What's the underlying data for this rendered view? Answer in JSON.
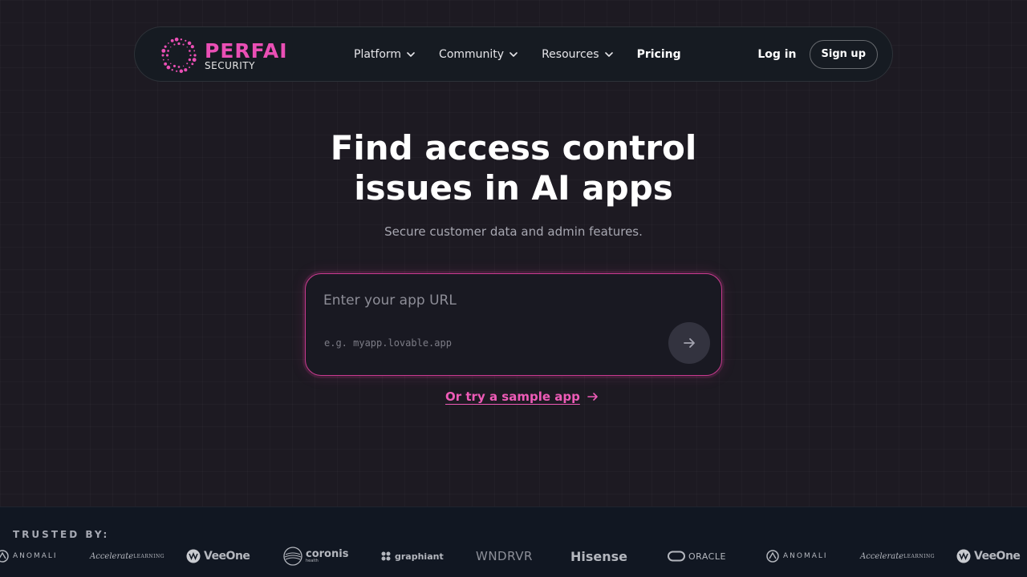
{
  "brand": {
    "name": "PERFAI",
    "sub": "SECURITY",
    "accent": "#ea4fb5"
  },
  "nav": {
    "items": [
      {
        "label": "Platform",
        "has_dropdown": true
      },
      {
        "label": "Community",
        "has_dropdown": true
      },
      {
        "label": "Resources",
        "has_dropdown": true
      },
      {
        "label": "Pricing",
        "has_dropdown": false
      }
    ],
    "login_label": "Log in",
    "signup_label": "Sign up"
  },
  "hero": {
    "title_line1": "Find access control",
    "title_line2": "issues in AI apps",
    "subtitle": "Secure customer data and admin features."
  },
  "url_form": {
    "placeholder": "Enter your app URL",
    "hint": "e.g. myapp.lovable.app",
    "submit_icon": "arrow-right-icon"
  },
  "sample_link": {
    "label": "Or try a sample app",
    "icon": "arrow-right-icon"
  },
  "trusted": {
    "label": "TRUSTED BY:",
    "logos": [
      {
        "name": "ANOMALI",
        "icon": "anomali-logo-icon"
      },
      {
        "name": "Accelerate",
        "suffix": "LEARNING"
      },
      {
        "name": "VeeOne",
        "icon": "veeone-logo-icon"
      },
      {
        "name": "coronis",
        "tagline": "health",
        "icon": "coronis-logo-icon"
      },
      {
        "name": "graphiant",
        "icon": "graphiant-logo-icon"
      },
      {
        "name": "WNDRVR"
      },
      {
        "name": "Hisense"
      },
      {
        "name": "ORACLE",
        "icon": "oracle-logo-icon"
      },
      {
        "name": "ANOMALI",
        "icon": "anomali-logo-icon"
      },
      {
        "name": "Accelerate",
        "suffix": "LEARNING"
      },
      {
        "name": "VeeOne",
        "icon": "veeone-logo-icon"
      }
    ]
  }
}
